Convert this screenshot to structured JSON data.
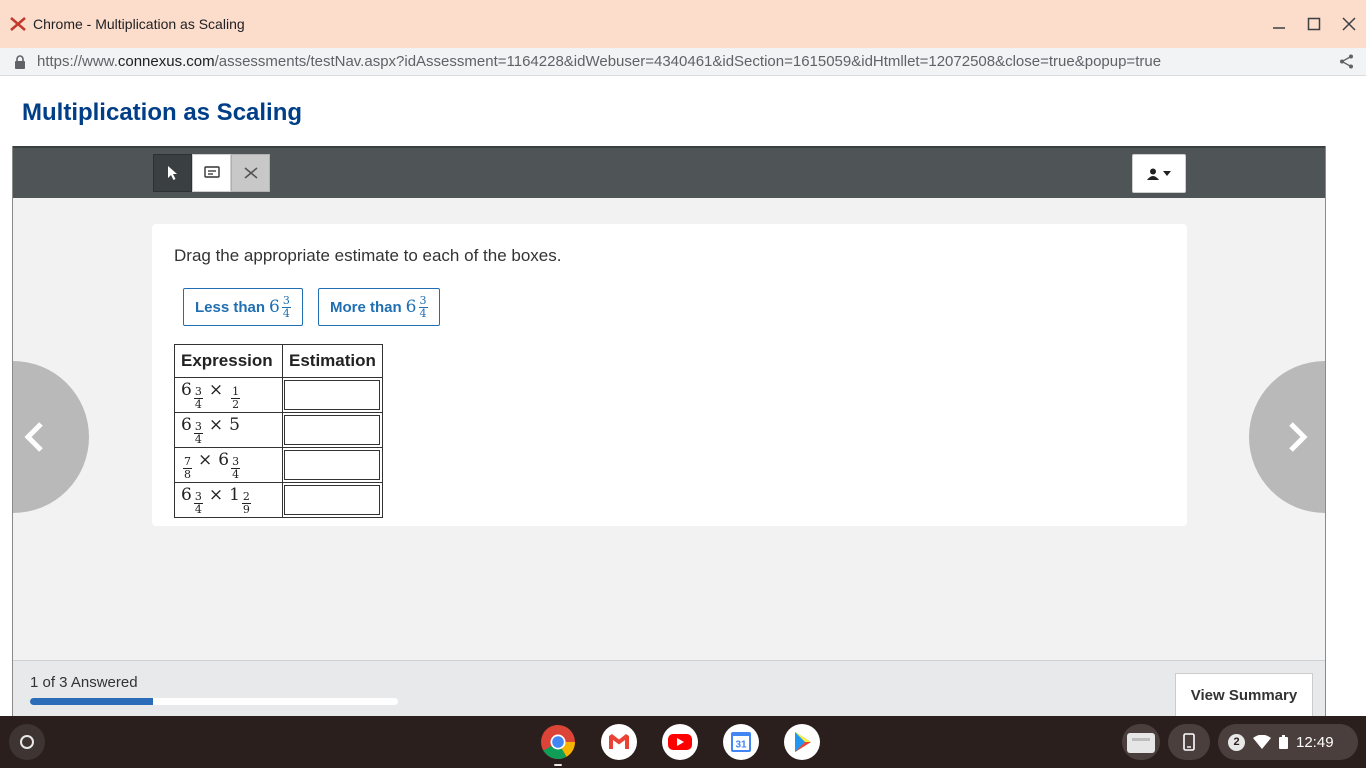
{
  "window": {
    "title": "Chrome - Multiplication as Scaling"
  },
  "address_bar": {
    "url_prefix": "https://www.",
    "url_domain": "connexus.com",
    "url_rest": "/assessments/testNav.aspx?idAssessment=1164228&idWebuser=4340461&idSection=1615059&idHtmllet=12072508&close=true&popup=true"
  },
  "page": {
    "title": "Multiplication as Scaling"
  },
  "question": {
    "prompt": "Drag the appropriate estimate to each of the boxes.",
    "choices": [
      {
        "prefix": "Less than",
        "whole": "6",
        "num": "3",
        "den": "4"
      },
      {
        "prefix": "More than",
        "whole": "6",
        "num": "3",
        "den": "4"
      }
    ],
    "table": {
      "headers": [
        "Expression",
        "Estimation"
      ],
      "rows": [
        {
          "a_whole": "6",
          "a_num": "3",
          "a_den": "4",
          "op": "×",
          "b_whole": "",
          "b_num": "1",
          "b_den": "2",
          "estimation": ""
        },
        {
          "a_whole": "6",
          "a_num": "3",
          "a_den": "4",
          "op": "×",
          "b_whole": "5",
          "b_num": "",
          "b_den": "",
          "estimation": ""
        },
        {
          "a_whole": "",
          "a_num": "7",
          "a_den": "8",
          "op": "×",
          "b_whole": "6",
          "b_num": "3",
          "b_den": "4",
          "estimation": ""
        },
        {
          "a_whole": "6",
          "a_num": "3",
          "a_den": "4",
          "op": "×",
          "b_whole": "1",
          "b_num": "2",
          "b_den": "9",
          "estimation": ""
        }
      ]
    }
  },
  "footer": {
    "progress_text": "1 of 3 Answered",
    "progress_fraction": 0.333,
    "view_summary_label": "View Summary"
  },
  "taskbar": {
    "apps": [
      "chrome-icon",
      "gmail-icon",
      "youtube-icon",
      "calendar-icon",
      "play-store-icon"
    ],
    "calendar_day": "31",
    "notification_count": "2",
    "clock": "12:49"
  },
  "colors": {
    "title_bar": "#fcdccb",
    "heading_blue": "#003f87",
    "chip_blue": "#1f6fb2",
    "progress_fill": "#2a6cb8"
  }
}
